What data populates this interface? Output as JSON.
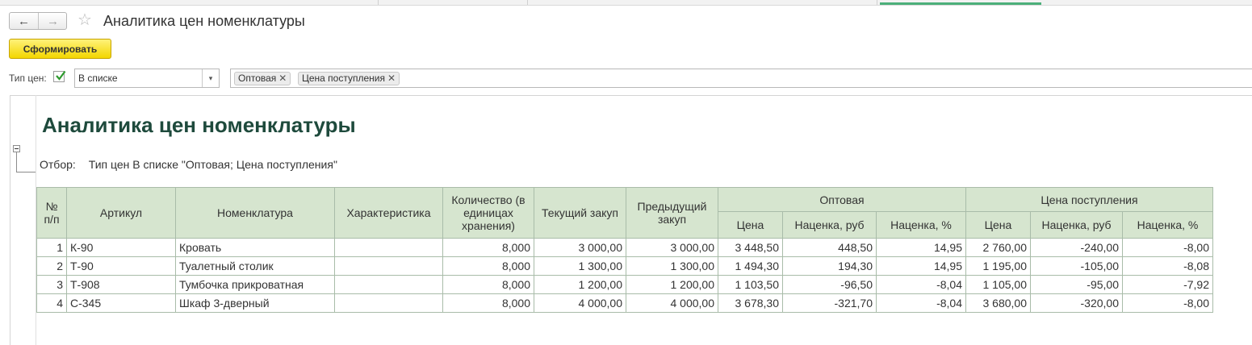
{
  "window": {
    "title": "Аналитика цен номенклатуры"
  },
  "nav": {
    "back_icon": "←",
    "forward_icon": "→",
    "favorite_icon": "☆"
  },
  "toolbar": {
    "generate_label": "Сформировать"
  },
  "filter_bar": {
    "label": "Тип цен:",
    "enabled": true,
    "condition": "В списке",
    "dropdown_icon": "▾",
    "tags": [
      "Оптовая",
      "Цена поступления"
    ],
    "remove_icon": "✕"
  },
  "report": {
    "title": "Аналитика цен номенклатуры",
    "filter_label": "Отбор:",
    "filter_text": "Тип цен В списке \"Оптовая; Цена поступления\"",
    "headers": {
      "num": "№ п/п",
      "article": "Артикул",
      "item": "Номенклатура",
      "characteristic": "Характеристика",
      "quantity": "Количество (в единицах хранения)",
      "current_purchase": "Текущий закуп",
      "previous_purchase": "Предыдущий закуп",
      "group_wholesale": "Оптовая",
      "group_receipt": "Цена поступления",
      "price": "Цена",
      "markup_rub": "Наценка, руб",
      "markup_pct": "Наценка, %"
    },
    "rows": [
      {
        "n": "1",
        "article": "К-90",
        "item": "Кровать",
        "characteristic": "",
        "qty": "8,000",
        "cur": "3 000,00",
        "prev": "3 000,00",
        "w_price": "3 448,50",
        "w_rub": "448,50",
        "w_pct": "14,95",
        "r_price": "2 760,00",
        "r_rub": "-240,00",
        "r_pct": "-8,00"
      },
      {
        "n": "2",
        "article": "Т-90",
        "item": "Туалетный столик",
        "characteristic": "",
        "qty": "8,000",
        "cur": "1 300,00",
        "prev": "1 300,00",
        "w_price": "1 494,30",
        "w_rub": "194,30",
        "w_pct": "14,95",
        "r_price": "1 195,00",
        "r_rub": "-105,00",
        "r_pct": "-8,08"
      },
      {
        "n": "3",
        "article": "Т-908",
        "item": "Тумбочка прикроватная",
        "characteristic": "",
        "qty": "8,000",
        "cur": "1 200,00",
        "prev": "1 200,00",
        "w_price": "1 103,50",
        "w_rub": "-96,50",
        "w_pct": "-8,04",
        "r_price": "1 105,00",
        "r_rub": "-95,00",
        "r_pct": "-7,92"
      },
      {
        "n": "4",
        "article": "С-345",
        "item": "Шкаф 3-дверный",
        "characteristic": "",
        "qty": "8,000",
        "cur": "4 000,00",
        "prev": "4 000,00",
        "w_price": "3 678,30",
        "w_rub": "-321,70",
        "w_pct": "-8,04",
        "r_price": "3 680,00",
        "r_rub": "-320,00",
        "r_pct": "-8,00"
      }
    ]
  }
}
